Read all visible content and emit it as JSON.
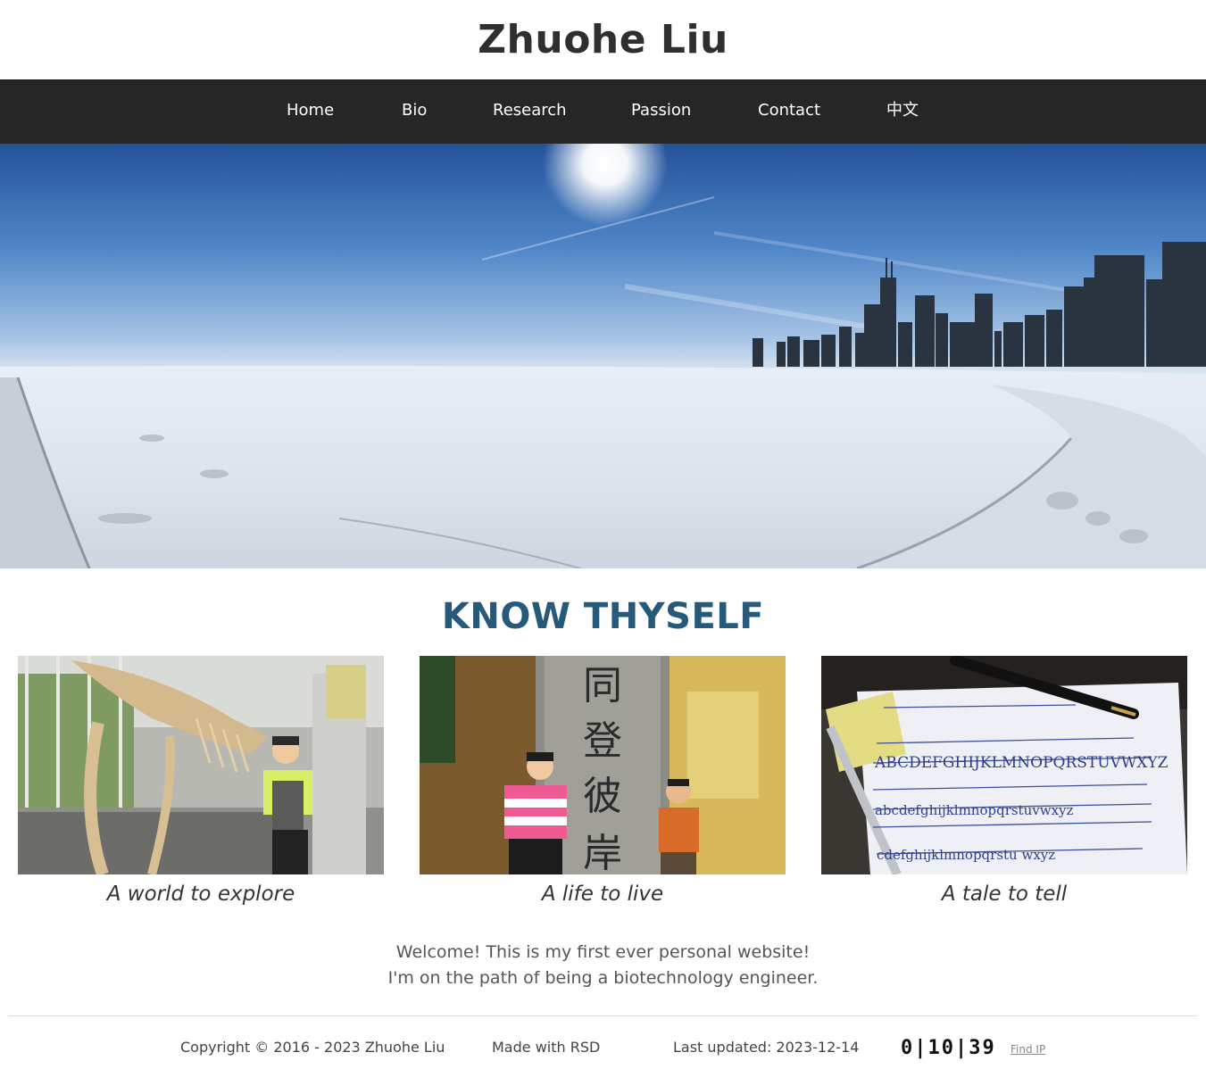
{
  "header": {
    "title": "Zhuohe Liu"
  },
  "nav": {
    "items": [
      {
        "label": "Home"
      },
      {
        "label": "Bio"
      },
      {
        "label": "Research"
      },
      {
        "label": "Passion"
      },
      {
        "label": "Contact"
      },
      {
        "label": "中文"
      }
    ]
  },
  "main": {
    "section_title": "KNOW THYSELF",
    "cards": [
      {
        "caption": "A world to explore"
      },
      {
        "caption": "A life to live"
      },
      {
        "caption": "A tale to tell"
      }
    ],
    "welcome_line1": "Welcome! This is my first ever personal website!",
    "welcome_line2": "I'm on the path of being a biotechnology engineer."
  },
  "footer": {
    "copyright": "Copyright © 2016 - 2023 Zhuohe Liu",
    "made_with": "Made with RSD",
    "last_updated": "Last updated: 2023-12-14",
    "visitor_counter": "0|10|39",
    "find_ip": "Find IP"
  },
  "colors": {
    "nav_background": "#262626",
    "section_title": "#275a7a"
  }
}
